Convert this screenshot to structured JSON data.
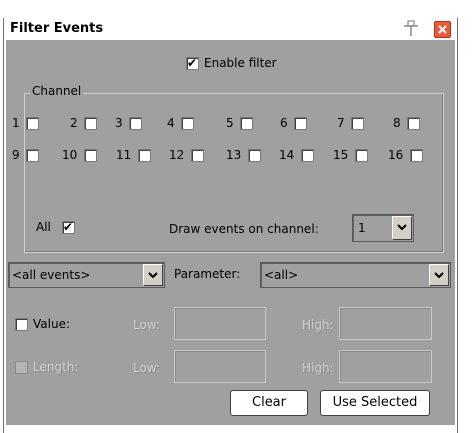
{
  "window": {
    "title": "Filter Events"
  },
  "enable_filter": {
    "label": "Enable filter",
    "checked": true
  },
  "channel_group": {
    "label": "Channel",
    "channels": [
      {
        "label": "1",
        "checked": false
      },
      {
        "label": "2",
        "checked": false
      },
      {
        "label": "3",
        "checked": false
      },
      {
        "label": "4",
        "checked": false
      },
      {
        "label": "5",
        "checked": false
      },
      {
        "label": "6",
        "checked": false
      },
      {
        "label": "7",
        "checked": false
      },
      {
        "label": "8",
        "checked": false
      },
      {
        "label": "9",
        "checked": false
      },
      {
        "label": "10",
        "checked": false
      },
      {
        "label": "11",
        "checked": false
      },
      {
        "label": "12",
        "checked": false
      },
      {
        "label": "13",
        "checked": false
      },
      {
        "label": "14",
        "checked": false
      },
      {
        "label": "15",
        "checked": false
      },
      {
        "label": "16",
        "checked": false
      }
    ],
    "all": {
      "label": "All",
      "checked": true
    },
    "draw_events_label": "Draw events on channel:",
    "draw_events_value": "1"
  },
  "event_type": {
    "value": "<all events>"
  },
  "parameter": {
    "label": "Parameter:",
    "value": "<all>"
  },
  "value_row": {
    "label": "Value:",
    "checked": false,
    "low_label": "Low:",
    "high_label": "High:"
  },
  "length_row": {
    "label": "Length:",
    "checked": false,
    "low_label": "Low:",
    "high_label": "High:"
  },
  "buttons": {
    "clear": "Clear",
    "use_selected": "Use Selected"
  },
  "icons": {
    "pin": "pin-icon",
    "close": "close-icon",
    "dropdown": "chevron-down-icon",
    "check": "checkmark-icon"
  },
  "colors": {
    "client_bg": "#a0a0a0",
    "close_button": "#e85a3a"
  }
}
